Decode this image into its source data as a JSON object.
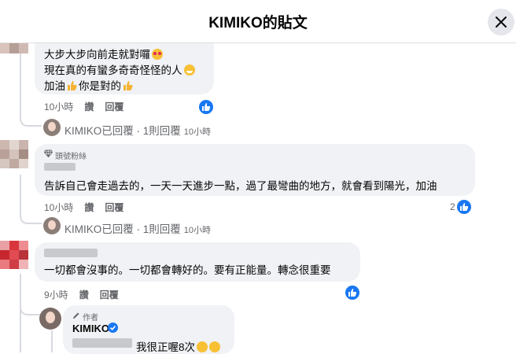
{
  "header": {
    "title": "KIMIKO的貼文"
  },
  "comment1": {
    "lines": [
      "大步大步向前走就對囉",
      "現在真的有蠻多奇奇怪怪的人",
      "加油",
      "你是對的"
    ],
    "time": "10小時",
    "reply": "讚",
    "respond": "回覆",
    "reply_summary": "KIMIKO已回覆 · 1則回覆",
    "reply_time": "10小時"
  },
  "comment2": {
    "badge": "頭號粉絲",
    "text": "告訴自己會走過去的，一天一天進步一點，過了最彎曲的地方，就會看到陽光，加油",
    "time": "10小時",
    "reply": "讚",
    "respond": "回覆",
    "like_count": "2",
    "reply_summary": "KIMIKO已回覆 · 1則回覆",
    "reply_time": "10小時"
  },
  "comment3": {
    "text": "一切都會沒事的。一切都會轉好的。要有正能量。轉念很重要",
    "time": "9小時",
    "reply": "讚",
    "respond": "回覆"
  },
  "reply": {
    "author_badge": "作者",
    "author": "KIMIKO",
    "text": "我很正喔8次"
  },
  "colors": {
    "accent": "#1877f2",
    "bubble": "#f0f2f5",
    "muted": "#65676b"
  },
  "icons": [
    "close-icon",
    "like-icon",
    "verified-badge-icon",
    "pencil-icon",
    "diamond-icon",
    "thumbs-up-emoji",
    "heart-eyes-emoji",
    "grin-emoji"
  ]
}
